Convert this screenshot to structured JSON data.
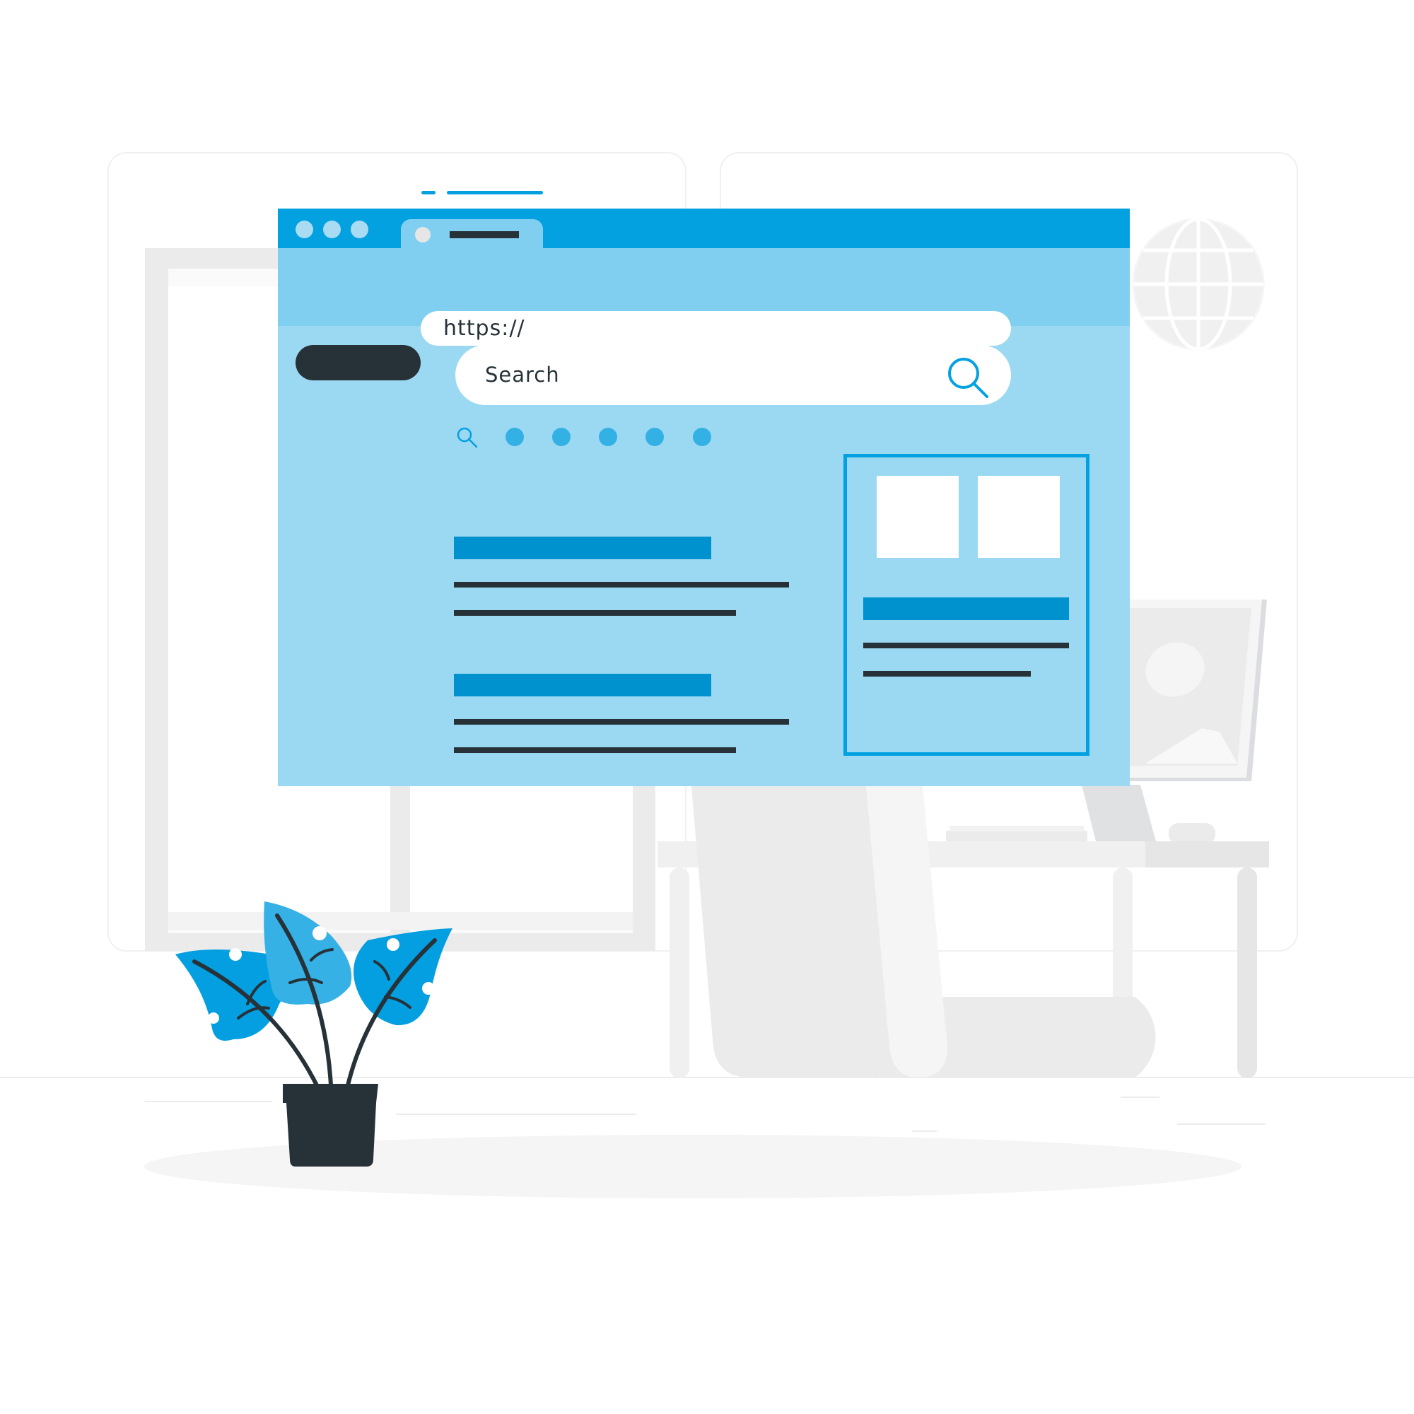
{
  "scene": {
    "description": "Web search illustration: browser window with search bar over an office background with plant, desk and monitor",
    "colors": {
      "primary": "#03a1e0",
      "address_band": "#80cff0",
      "content_bg": "#9bd8f2",
      "headline": "#0091cf",
      "dark": "#263238",
      "dot": "#33b1e5",
      "leaf_light": "#36b1e6",
      "leaf": "#049fe0",
      "background_gray": "#ebebeb"
    }
  },
  "browser": {
    "window_controls": [
      "dot",
      "dot",
      "dot"
    ],
    "tab": {
      "icon": "tab-favicon",
      "title_placeholder": ""
    },
    "address_bar": {
      "value": "https://"
    },
    "search": {
      "placeholder": "Search",
      "icon": "search-icon"
    },
    "pagination": {
      "icon": "search-icon-small",
      "dots": 5
    },
    "results": [
      {
        "headline": "",
        "lines": 2
      },
      {
        "headline": "",
        "lines": 2
      }
    ],
    "side_card": {
      "thumbnails": 2,
      "lines": 2
    }
  },
  "background": {
    "icons": [
      "globe-icon",
      "monitor-image-icon"
    ]
  }
}
